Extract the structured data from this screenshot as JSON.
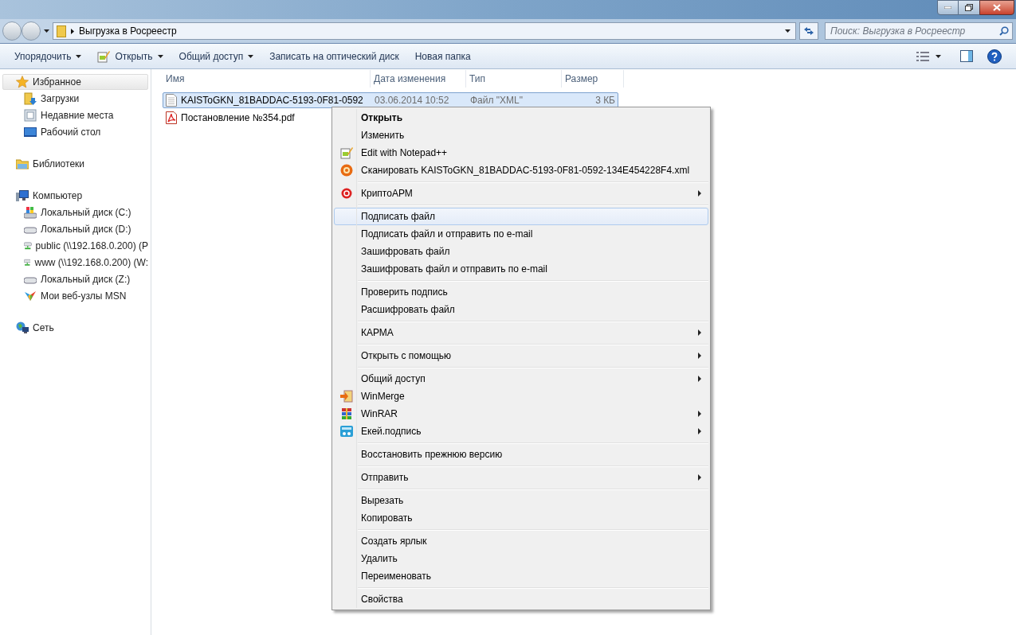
{
  "address_bar": {
    "path": "Выгрузка в Росреестр"
  },
  "search": {
    "placeholder": "Поиск: Выгрузка в Росреестр"
  },
  "toolbar": [
    {
      "label": "Упорядочить",
      "dropdown": true,
      "kind": "text"
    },
    {
      "label": "Открыть",
      "dropdown": true,
      "kind": "notepad"
    },
    {
      "label": "Общий доступ",
      "dropdown": true,
      "kind": "text"
    },
    {
      "label": "Записать на оптический диск",
      "dropdown": false,
      "kind": "text"
    },
    {
      "label": "Новая папка",
      "dropdown": false,
      "kind": "text"
    }
  ],
  "sidebar": [
    {
      "label": "Избранное",
      "kind": "star",
      "selected": true,
      "children": [
        {
          "label": "Загрузки",
          "kind": "downloads",
          "selected": false
        },
        {
          "label": "Недавние места",
          "kind": "recent",
          "selected": false
        },
        {
          "label": "Рабочий стол",
          "kind": "desktop",
          "selected": false
        }
      ]
    },
    {
      "label": "Библиотеки",
      "kind": "library",
      "selected": false
    },
    {
      "label": "Компьютер",
      "kind": "computer",
      "selected": false,
      "children": [
        {
          "label": "Локальный диск (C:)",
          "kind": "sysdisk",
          "selected": false
        },
        {
          "label": "Локальный диск (D:)",
          "kind": "disk",
          "selected": false
        },
        {
          "label": "public (\\\\192.168.0.200) (P",
          "kind": "netdrive",
          "selected": false
        },
        {
          "label": "www (\\\\192.168.0.200) (W:",
          "kind": "netdrive",
          "selected": false
        },
        {
          "label": "Локальный диск (Z:)",
          "kind": "disk",
          "selected": false
        },
        {
          "label": "Мои веб-узлы MSN",
          "kind": "msn",
          "selected": false
        }
      ]
    },
    {
      "label": "Сеть",
      "kind": "network",
      "selected": false
    }
  ],
  "columns": [
    "Имя",
    "Дата изменения",
    "Тип",
    "Размер"
  ],
  "files": [
    {
      "name": "KAISToGKN_81BADDAC-5193-0F81-0592",
      "date": "03.06.2014 10:52",
      "type": "Файл \"XML\"",
      "size": "3 КБ",
      "kind": "xml",
      "selected": true
    },
    {
      "name": "Постановление №354.pdf",
      "kind": "pdf",
      "selected": false
    }
  ],
  "context_menu": [
    [
      {
        "label": "Открыть",
        "kind": "plain",
        "default": true,
        "selected": false,
        "submenu": false
      },
      {
        "label": "Изменить",
        "kind": "plain",
        "default": false,
        "selected": false,
        "submenu": false
      },
      {
        "label": "Edit with Notepad++",
        "kind": "notepad",
        "default": false,
        "selected": false,
        "submenu": false
      },
      {
        "label": "Сканировать KAISToGKN_81BADDAC-5193-0F81-0592-134E454228F4.xml",
        "kind": "scan",
        "default": false,
        "selected": false,
        "submenu": false
      }
    ],
    [
      {
        "label": "КриптоАРМ",
        "kind": "crypto",
        "default": false,
        "selected": false,
        "submenu": true
      }
    ],
    [
      {
        "label": "Подписать файл",
        "kind": "plain",
        "default": false,
        "selected": true,
        "submenu": false
      },
      {
        "label": "Подписать файл и отправить по e-mail",
        "kind": "plain",
        "default": false,
        "selected": false,
        "submenu": false
      },
      {
        "label": "Зашифровать файл",
        "kind": "plain",
        "default": false,
        "selected": false,
        "submenu": false
      },
      {
        "label": "Зашифровать файл и отправить по e-mail",
        "kind": "plain",
        "default": false,
        "selected": false,
        "submenu": false
      }
    ],
    [
      {
        "label": "Проверить подпись",
        "kind": "plain",
        "default": false,
        "selected": false,
        "submenu": false
      },
      {
        "label": "Расшифровать файл",
        "kind": "plain",
        "default": false,
        "selected": false,
        "submenu": false
      }
    ],
    [
      {
        "label": "КАРМА",
        "kind": "plain",
        "default": false,
        "selected": false,
        "submenu": true
      }
    ],
    [
      {
        "label": "Открыть с помощью",
        "kind": "plain",
        "default": false,
        "selected": false,
        "submenu": true
      }
    ],
    [
      {
        "label": "Общий доступ",
        "kind": "plain",
        "default": false,
        "selected": false,
        "submenu": true
      },
      {
        "label": "WinMerge",
        "kind": "winmerge",
        "default": false,
        "selected": false,
        "submenu": false
      },
      {
        "label": "WinRAR",
        "kind": "winrar",
        "default": false,
        "selected": false,
        "submenu": true
      },
      {
        "label": "Екей.подпись",
        "kind": "ekey",
        "default": false,
        "selected": false,
        "submenu": true
      }
    ],
    [
      {
        "label": "Восстановить прежнюю версию",
        "kind": "plain",
        "default": false,
        "selected": false,
        "submenu": false
      }
    ],
    [
      {
        "label": "Отправить",
        "kind": "plain",
        "default": false,
        "selected": false,
        "submenu": true
      }
    ],
    [
      {
        "label": "Вырезать",
        "kind": "plain",
        "default": false,
        "selected": false,
        "submenu": false
      },
      {
        "label": "Копировать",
        "kind": "plain",
        "default": false,
        "selected": false,
        "submenu": false
      }
    ],
    [
      {
        "label": "Создать ярлык",
        "kind": "plain",
        "default": false,
        "selected": false,
        "submenu": false
      },
      {
        "label": "Удалить",
        "kind": "plain",
        "default": false,
        "selected": false,
        "submenu": false
      },
      {
        "label": "Переименовать",
        "kind": "plain",
        "default": false,
        "selected": false,
        "submenu": false
      }
    ],
    [
      {
        "label": "Свойства",
        "kind": "plain",
        "default": false,
        "selected": false,
        "submenu": false
      }
    ]
  ]
}
